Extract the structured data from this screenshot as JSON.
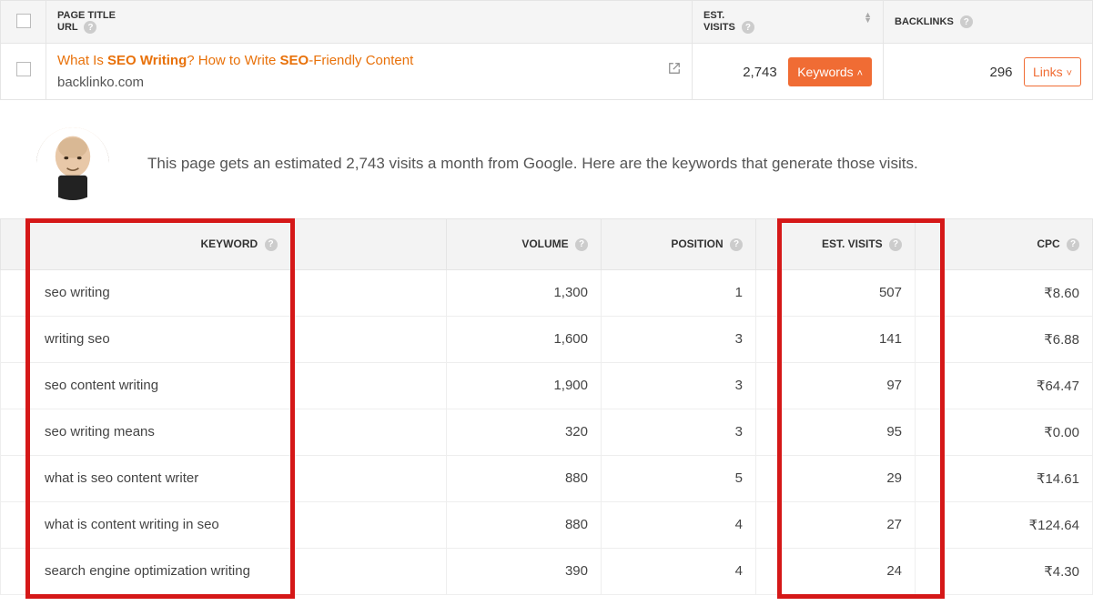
{
  "topTable": {
    "headers": {
      "pageTitle": "PAGE TITLE",
      "url": "URL",
      "estVisits": "EST.",
      "estVisits2": "VISITS",
      "backlinks": "BACKLINKS"
    },
    "row": {
      "title_pre": "What Is ",
      "title_b1": "SEO Writing",
      "title_mid": "? How to Write ",
      "title_b2": "SEO",
      "title_post": "-Friendly Content",
      "domain": "backlinko.com",
      "estVisits": "2,743",
      "keywordsBtn": "Keywords",
      "backlinks": "296",
      "linksBtn": "Links"
    }
  },
  "advisorText": "This page gets an estimated 2,743 visits a month from Google. Here are the keywords that generate those visits.",
  "kwHeaders": {
    "keyword": "KEYWORD",
    "volume": "VOLUME",
    "position": "POSITION",
    "estVisits": "EST. VISITS",
    "cpc": "CPC"
  },
  "kwRows": [
    {
      "kw": "seo writing",
      "vol": "1,300",
      "pos": "1",
      "ev": "507",
      "cpc": "₹8.60"
    },
    {
      "kw": "writing seo",
      "vol": "1,600",
      "pos": "3",
      "ev": "141",
      "cpc": "₹6.88"
    },
    {
      "kw": "seo content writing",
      "vol": "1,900",
      "pos": "3",
      "ev": "97",
      "cpc": "₹64.47"
    },
    {
      "kw": "seo writing means",
      "vol": "320",
      "pos": "3",
      "ev": "95",
      "cpc": "₹0.00"
    },
    {
      "kw": "what is seo content writer",
      "vol": "880",
      "pos": "5",
      "ev": "29",
      "cpc": "₹14.61"
    },
    {
      "kw": "what is content writing in seo",
      "vol": "880",
      "pos": "4",
      "ev": "27",
      "cpc": "₹124.64"
    },
    {
      "kw": "search engine optimization writing",
      "vol": "390",
      "pos": "4",
      "ev": "24",
      "cpc": "₹4.30"
    }
  ],
  "chart_data": {
    "type": "table",
    "title": "Keyword traffic breakdown",
    "columns": [
      "Keyword",
      "Volume",
      "Position",
      "Est. Visits",
      "CPC (₹)"
    ],
    "rows": [
      [
        "seo writing",
        1300,
        1,
        507,
        8.6
      ],
      [
        "writing seo",
        1600,
        3,
        141,
        6.88
      ],
      [
        "seo content writing",
        1900,
        3,
        97,
        64.47
      ],
      [
        "seo writing means",
        320,
        3,
        95,
        0.0
      ],
      [
        "what is seo content writer",
        880,
        5,
        29,
        14.61
      ],
      [
        "what is content writing in seo",
        880,
        4,
        27,
        124.64
      ],
      [
        "search engine optimization writing",
        390,
        4,
        24,
        4.3
      ]
    ]
  }
}
